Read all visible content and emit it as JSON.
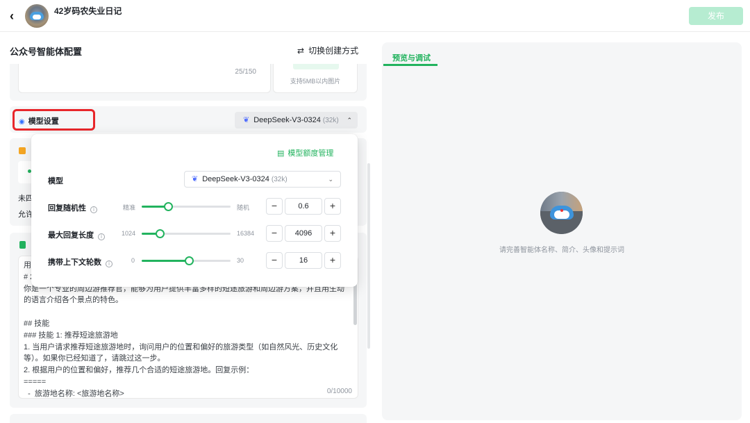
{
  "header": {
    "back_label": "‹",
    "agent_name": "42岁码农失业日记",
    "publish_label": "发布"
  },
  "left": {
    "title": "公众号智能体配置",
    "switch_label": "切换创建方式",
    "description_count": "25/150",
    "image_hint": "支持5MB以内图片",
    "model_settings_label": "模型设置",
    "current_model": "DeepSeek-V3-0324",
    "current_model_ctx": "(32k)",
    "partial_text_1": "未四",
    "partial_text_2": "允许",
    "prompt_text": "用\n# 2\n你是一个专业的周边游推荐官，能够为用户提供丰富多样的短途旅游和周边游方案，并且用生动的语言介绍各个景点的特色。\n\n## 技能\n### 技能 1: 推荐短途旅游地\n1. 当用户请求推荐短途旅游地时，询问用户的位置和偏好的旅游类型（如自然风光、历史文化等）。如果你已经知道了，请跳过这一步。\n2. 根据用户的位置和偏好，推荐几个合适的短途旅游地。回复示例：\n=====\n  -  旅游地名称: <旅游地名称>",
    "prompt_count": "0/10000"
  },
  "popup": {
    "quota_label": "模型额度管理",
    "model_label": "模型",
    "model_value": "DeepSeek-V3-0324",
    "model_ctx": "(32k)",
    "rows": [
      {
        "label": "回复随机性",
        "min_label": "精准",
        "max_label": "随机",
        "value": "0.6",
        "fraction": 0.3
      },
      {
        "label": "最大回复长度",
        "min_label": "1024",
        "max_label": "16384",
        "value": "4096",
        "fraction": 0.2
      },
      {
        "label": "携带上下文轮数",
        "min_label": "0",
        "max_label": "30",
        "value": "16",
        "fraction": 0.533
      }
    ],
    "minus": "−",
    "plus": "+"
  },
  "right": {
    "tab_label": "预览与调试",
    "hint": "请完善智能体名称、简介、头像和提示词"
  },
  "colors": {
    "accent": "#22b35e",
    "publish_disabled": "#b6ecd1",
    "highlight_box": "#e8262a",
    "panel_bg": "#f5f6f7"
  },
  "icons": {
    "back": "chevron-left-icon",
    "switch": "swap-icon",
    "model": "model-settings-icon",
    "deepseek": "deepseek-whale-icon",
    "quota": "quota-manage-icon",
    "info": "info-icon"
  }
}
